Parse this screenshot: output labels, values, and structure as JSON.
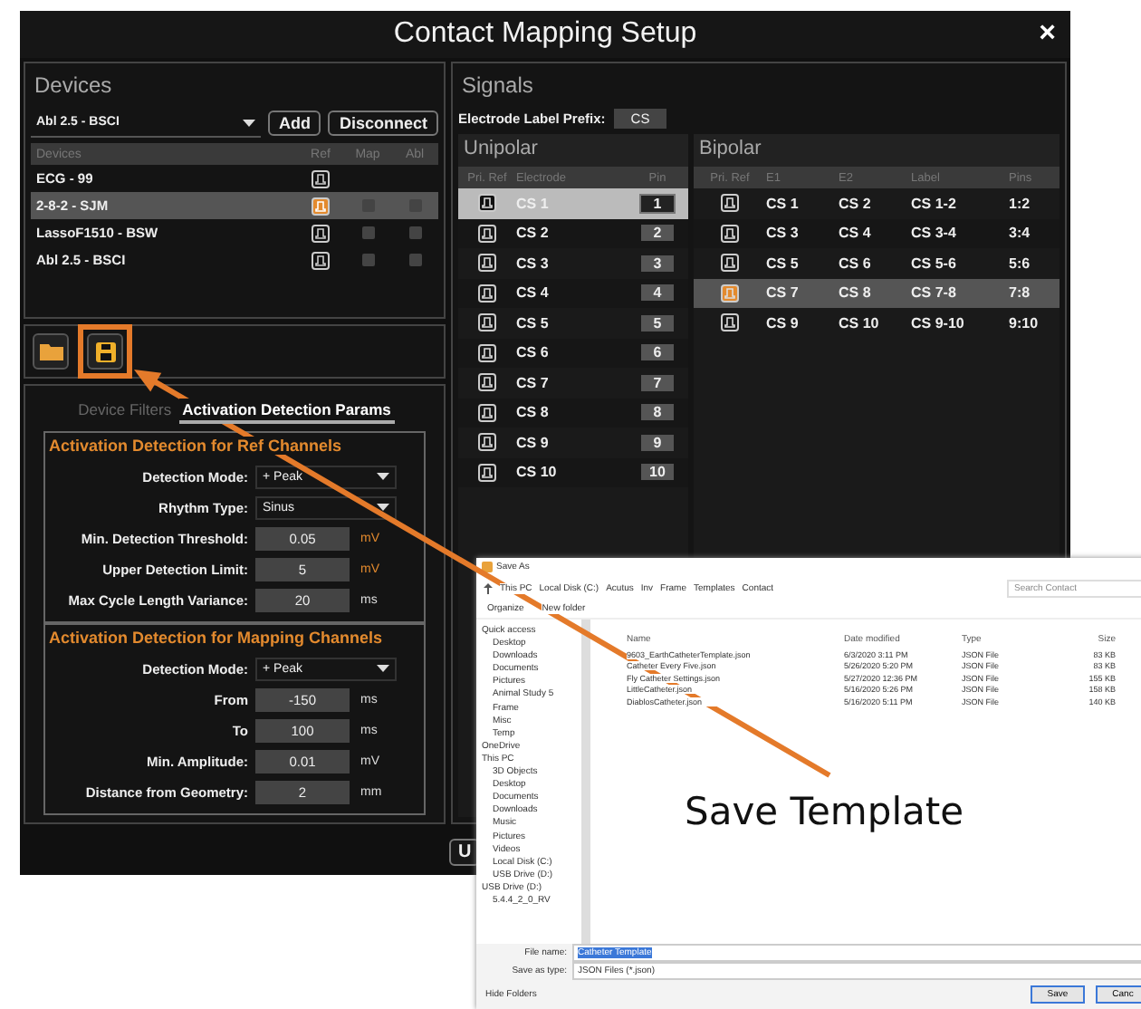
{
  "window": {
    "title": "Contact Mapping Setup",
    "close": "×"
  },
  "devices": {
    "title": "Devices",
    "dropdown": "Abl 2.5 - BSCI",
    "add": "Add",
    "disconnect": "Disconnect",
    "columns": [
      "Devices",
      "Ref",
      "Map",
      "Abl"
    ],
    "rows": [
      {
        "name": "ECG - 99",
        "selected": false,
        "ref": false
      },
      {
        "name": "2-8-2 - SJM",
        "selected": true,
        "ref": true,
        "map": false,
        "abl": false
      },
      {
        "name": "LassoF1510 - BSW",
        "selected": false,
        "ref": false,
        "map": false,
        "abl": false
      },
      {
        "name": "Abl 2.5 - BSCI",
        "selected": false,
        "ref": false,
        "map": false,
        "abl": false
      }
    ]
  },
  "params": {
    "tabs": [
      {
        "label": "Device Filters",
        "selected": false
      },
      {
        "label": "Activation Detection Params",
        "selected": true
      }
    ],
    "sections": [
      {
        "title": "Activation Detection for Ref Channels",
        "fields": [
          {
            "kind": "select",
            "label": "Detection Mode:",
            "value": "+ Peak"
          },
          {
            "kind": "select",
            "label": "Rhythm Type:",
            "value": "Sinus"
          },
          {
            "kind": "number",
            "label": "Min. Detection Threshold:",
            "value": "0.05",
            "unit": "mV",
            "accent": true
          },
          {
            "kind": "number",
            "label": "Upper Detection Limit:",
            "value": "5",
            "unit": "mV",
            "accent": true
          },
          {
            "kind": "number",
            "label": "Max Cycle Length Variance:",
            "value": "20",
            "unit": "ms",
            "accent": false
          }
        ]
      },
      {
        "title": "Activation Detection for Mapping Channels",
        "fields": [
          {
            "kind": "select",
            "label": "Detection Mode:",
            "value": "+ Peak"
          },
          {
            "kind": "number",
            "label": "From",
            "value": "-150",
            "unit": "ms",
            "accent": false
          },
          {
            "kind": "number",
            "label": "To",
            "value": "100",
            "unit": "ms",
            "accent": false
          },
          {
            "kind": "number",
            "label": "Min. Amplitude:",
            "value": "0.01",
            "unit": "mV",
            "accent": false
          },
          {
            "kind": "number",
            "label": "Distance from Geometry:",
            "value": "2",
            "unit": "mm",
            "accent": false
          }
        ]
      }
    ]
  },
  "signals": {
    "title": "Signals",
    "prefix_label": "Electrode Label Prefix:",
    "prefix": "CS",
    "unipolar": {
      "title": "Unipolar",
      "columns": [
        "Pri. Ref",
        "Electrode",
        "Pin"
      ],
      "rows": [
        {
          "electrode": "CS 1",
          "pin": "1",
          "selected": true,
          "ref": false
        },
        {
          "electrode": "CS 2",
          "pin": "2",
          "selected": false,
          "ref": false
        },
        {
          "electrode": "CS 3",
          "pin": "3",
          "selected": false,
          "ref": false
        },
        {
          "electrode": "CS 4",
          "pin": "4",
          "selected": false,
          "ref": false
        },
        {
          "electrode": "CS 5",
          "pin": "5",
          "selected": false,
          "ref": false
        },
        {
          "electrode": "CS 6",
          "pin": "6",
          "selected": false,
          "ref": false
        },
        {
          "electrode": "CS 7",
          "pin": "7",
          "selected": false,
          "ref": false
        },
        {
          "electrode": "CS 8",
          "pin": "8",
          "selected": false,
          "ref": false
        },
        {
          "electrode": "CS 9",
          "pin": "9",
          "selected": false,
          "ref": false
        },
        {
          "electrode": "CS 10",
          "pin": "10",
          "selected": false,
          "ref": false
        }
      ]
    },
    "bipolar": {
      "title": "Bipolar",
      "columns": [
        "Pri. Ref",
        "E1",
        "E2",
        "Label",
        "Pins"
      ],
      "rows": [
        {
          "e1": "CS 1",
          "e2": "CS 2",
          "label": "CS 1-2",
          "pins": "1:2",
          "selected": false,
          "ref": false
        },
        {
          "e1": "CS 3",
          "e2": "CS 4",
          "label": "CS 3-4",
          "pins": "3:4",
          "selected": false,
          "ref": false
        },
        {
          "e1": "CS 5",
          "e2": "CS 6",
          "label": "CS 5-6",
          "pins": "5:6",
          "selected": false,
          "ref": false
        },
        {
          "e1": "CS 7",
          "e2": "CS 8",
          "label": "CS 7-8",
          "pins": "7:8",
          "selected": true,
          "ref": true
        },
        {
          "e1": "CS 9",
          "e2": "CS 10",
          "label": "CS 9-10",
          "pins": "9:10",
          "selected": false,
          "ref": false
        }
      ]
    }
  },
  "footer": {
    "button": "U"
  },
  "save_dialog": {
    "title": "Save As",
    "path": [
      "This PC",
      "Local Disk (C:)",
      "Acutus",
      "Inv",
      "Frame",
      "Templates",
      "Contact"
    ],
    "search": {
      "placeholder": "Search Contact"
    },
    "commands": [
      "Organize",
      "New folder"
    ],
    "sidebar": [
      {
        "label": "Quick access",
        "children": [
          {
            "label": "Desktop"
          },
          {
            "label": "Downloads"
          },
          {
            "label": "Documents"
          },
          {
            "label": "Pictures"
          },
          {
            "label": "Animal Study 5"
          },
          {
            "label": "Frame"
          },
          {
            "label": "Misc"
          },
          {
            "label": "Temp"
          }
        ]
      },
      {
        "label": "OneDrive"
      },
      {
        "label": "This PC",
        "children": [
          {
            "label": "3D Objects"
          },
          {
            "label": "Desktop"
          },
          {
            "label": "Documents"
          },
          {
            "label": "Downloads"
          },
          {
            "label": "Music"
          },
          {
            "label": "Pictures"
          },
          {
            "label": "Videos"
          },
          {
            "label": "Local Disk (C:)"
          },
          {
            "label": "USB Drive (D:)"
          }
        ]
      },
      {
        "label": "USB Drive (D:)",
        "children": [
          {
            "label": "5.4.4_2_0_RV"
          }
        ]
      }
    ],
    "columns": [
      "Name",
      "Date modified",
      "Type",
      "Size"
    ],
    "files": [
      {
        "name": "9603_EarthCatheterTemplate.json",
        "date": "6/3/2020 3:11 PM",
        "type": "JSON File",
        "size": "83 KB"
      },
      {
        "name": "Catheter Every Five.json",
        "date": "5/26/2020 5:20 PM",
        "type": "JSON File",
        "size": "83 KB"
      },
      {
        "name": "Fly Catheter Settings.json",
        "date": "5/27/2020 12:36 PM",
        "type": "JSON File",
        "size": "155 KB"
      },
      {
        "name": "LittleCatheter.json",
        "date": "5/16/2020 5:26 PM",
        "type": "JSON File",
        "size": "158 KB"
      },
      {
        "name": "DiablosCatheter.json",
        "date": "5/16/2020 5:11 PM",
        "type": "JSON File",
        "size": "140 KB"
      }
    ],
    "file_name_label": "File name:",
    "file_name": "Catheter Template",
    "type_label": "Save as type:",
    "file_type": "JSON Files (*.json)",
    "hide_folders": "Hide Folders",
    "buttons": [
      "Save",
      "Canc"
    ]
  },
  "annotation": "Save Template"
}
